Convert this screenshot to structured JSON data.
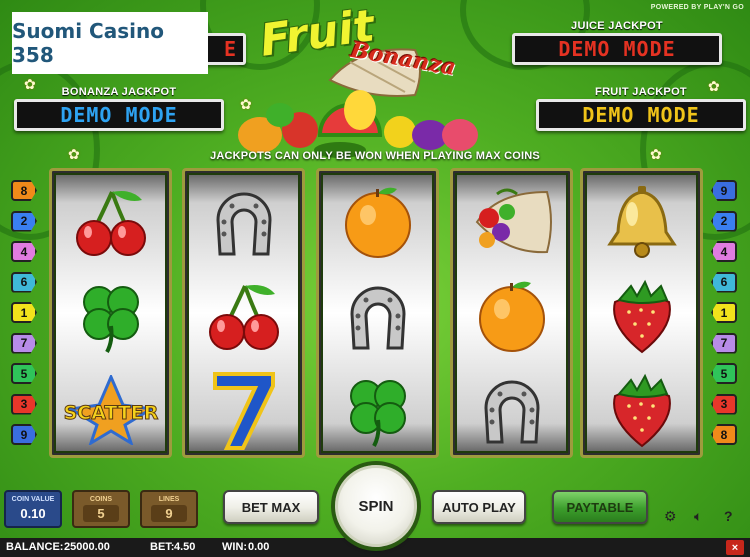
{
  "logo": {
    "text": "Suomi Casino 358"
  },
  "powered_by": "POWERED BY PLAY'N GO",
  "title": {
    "line1": "Fruit",
    "line2": "Bonanza"
  },
  "jackpots": [
    {
      "label": "BONANZA JACKPOT",
      "value": "DEMO MODE",
      "color": "#2ea3f2"
    },
    {
      "label": "JUICE JACKPOT",
      "value": "DEMO MODE",
      "color": "#e53222"
    },
    {
      "label": "FRUIT JACKPOT",
      "value": "DEMO MODE",
      "color": "#f0c419"
    }
  ],
  "partial_jackpot_display": "E",
  "max_coins_note": "JACKPOTS CAN ONLY BE WON WHEN PLAYING MAX COINS",
  "paylines": {
    "left": [
      {
        "num": "8",
        "color": "#f08a1a"
      },
      {
        "num": "2",
        "color": "#3a7ff0"
      },
      {
        "num": "4",
        "color": "#e07ce0"
      },
      {
        "num": "6",
        "color": "#3fb8d8"
      },
      {
        "num": "1",
        "color": "#f2e21c"
      },
      {
        "num": "7",
        "color": "#b88ce8"
      },
      {
        "num": "5",
        "color": "#2fc45a"
      },
      {
        "num": "3",
        "color": "#e8372a"
      },
      {
        "num": "9",
        "color": "#3a6ee0"
      }
    ],
    "right": [
      {
        "num": "9",
        "color": "#3a6ee0"
      },
      {
        "num": "2",
        "color": "#3a7ff0"
      },
      {
        "num": "4",
        "color": "#e07ce0"
      },
      {
        "num": "6",
        "color": "#3fb8d8"
      },
      {
        "num": "1",
        "color": "#f2e21c"
      },
      {
        "num": "7",
        "color": "#b88ce8"
      },
      {
        "num": "5",
        "color": "#2fc45a"
      },
      {
        "num": "3",
        "color": "#e8372a"
      },
      {
        "num": "8",
        "color": "#f08a1a"
      }
    ]
  },
  "reels": [
    [
      "cherries",
      "clover",
      "scatter"
    ],
    [
      "horseshoe",
      "cherries",
      "seven"
    ],
    [
      "orange",
      "horseshoe",
      "clover"
    ],
    [
      "cornucopia",
      "orange",
      "horseshoe"
    ],
    [
      "bell",
      "strawberry",
      "strawberry"
    ]
  ],
  "scatter_text": "SCATTER",
  "seven_text": "7",
  "controls": {
    "coin_value": {
      "label": "COIN VALUE",
      "value": "0.10"
    },
    "coins": {
      "label": "COINS",
      "value": "5"
    },
    "lines": {
      "label": "LINES",
      "value": "9"
    },
    "bet_max": "BET MAX",
    "spin": "SPIN",
    "auto_play": "AUTO PLAY",
    "paytable": "PAYTABLE",
    "help": "?"
  },
  "status": {
    "balance_label": "BALANCE:",
    "balance": "25000.00",
    "bet_label": "BET:",
    "bet": "4.50",
    "win_label": "WIN:",
    "win": "0.00",
    "close": "×"
  }
}
